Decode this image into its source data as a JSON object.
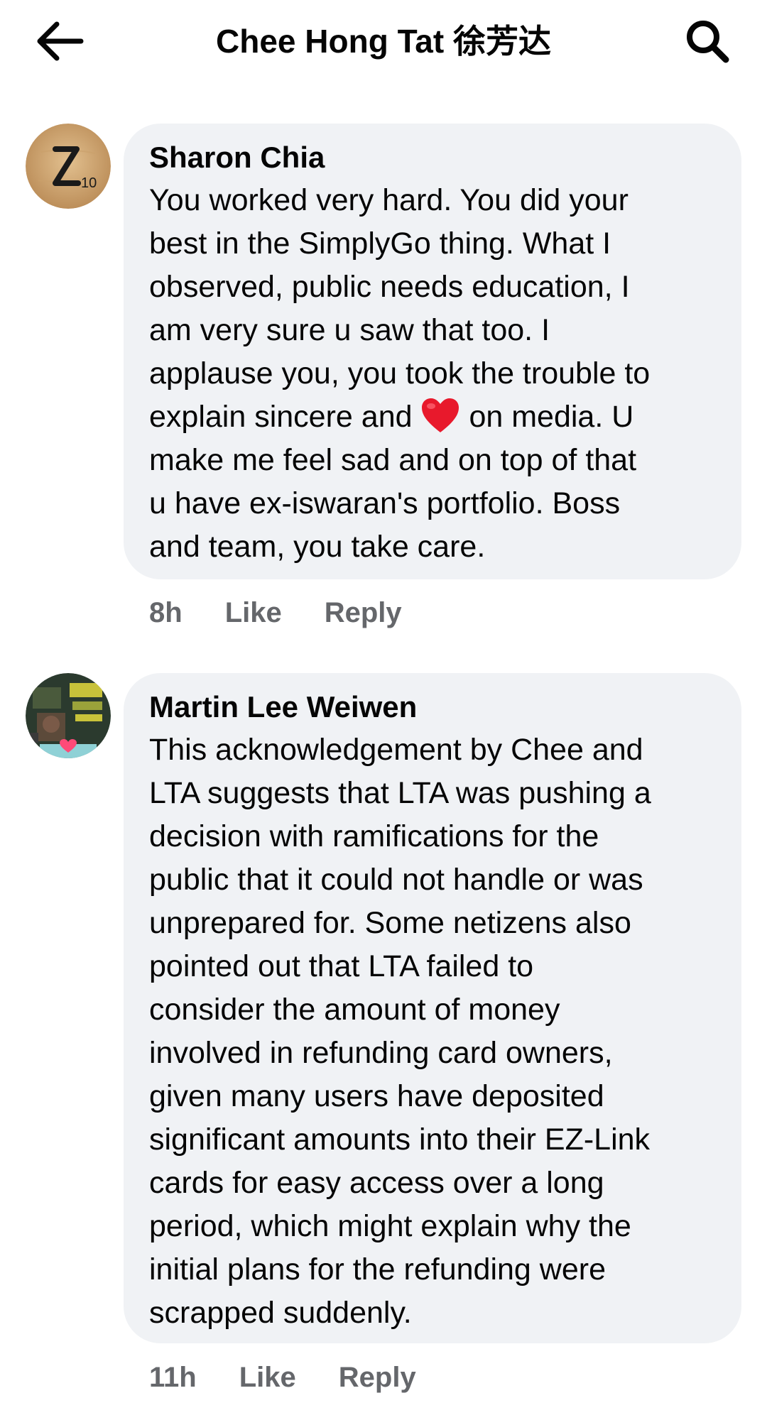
{
  "header": {
    "back_icon": "arrow-left-icon",
    "title": "Chee Hong Tat 徐芳达",
    "search_icon": "search-icon"
  },
  "comments": [
    {
      "author": "Sharon Chia",
      "avatar_icon": "scrabble-tile-z-avatar",
      "text_lines": [
        "You worked very hard. You did your",
        "best in the SimplyGo thing. What I",
        "observed, public needs education, I",
        "am very sure u saw that too. I",
        "applause  you, you took the trouble to",
        "explain sincere and",
        "on media. U",
        "make me feel sad and on top of that",
        "u have ex-iswaran's portfolio. Boss",
        "and team, you take care."
      ],
      "emoji": "red-heart-emoji",
      "time": "8h",
      "like_label": "Like",
      "reply_label": "Reply"
    },
    {
      "author": "Martin Lee Weiwen",
      "avatar_icon": "collage-photo-avatar",
      "text_lines": [
        "This acknowledgement by Chee and",
        "LTA suggests that LTA was pushing a",
        "decision with ramifications for the",
        "public that it could not handle or was",
        "unprepared for. Some netizens also",
        "pointed out that LTA failed to",
        "consider the amount of money",
        "involved in refunding card owners,",
        "given many users have deposited",
        "significant amounts into their EZ-Link",
        "cards for easy access over a long",
        "period, which might explain why the",
        "initial plans for the refunding were",
        "scrapped suddenly."
      ],
      "time": "11h",
      "like_label": "Like",
      "reply_label": "Reply"
    }
  ],
  "colors": {
    "bubble_bg": "#f0f2f5",
    "text": "#050505",
    "meta_gray": "#65676b",
    "heart_red": "#e8192c"
  }
}
